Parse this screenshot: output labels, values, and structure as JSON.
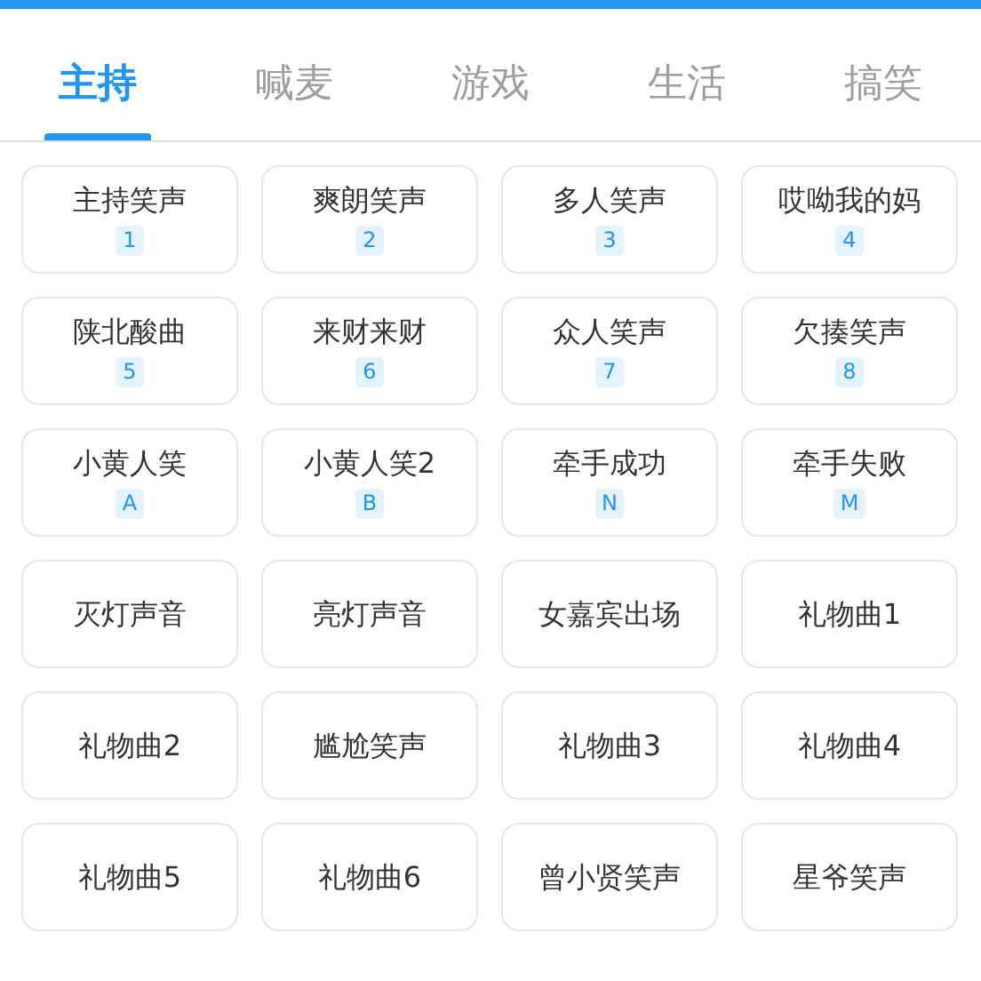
{
  "tabs": [
    {
      "label": "主持",
      "selected": true
    },
    {
      "label": "喊麦",
      "selected": false
    },
    {
      "label": "游戏",
      "selected": false
    },
    {
      "label": "生活",
      "selected": false
    },
    {
      "label": "搞笑",
      "selected": false
    }
  ],
  "sounds": [
    {
      "label": "主持笑声",
      "shortcut": "1"
    },
    {
      "label": "爽朗笑声",
      "shortcut": "2"
    },
    {
      "label": "多人笑声",
      "shortcut": "3"
    },
    {
      "label": "哎呦我的妈",
      "shortcut": "4"
    },
    {
      "label": "陕北酸曲",
      "shortcut": "5"
    },
    {
      "label": "来财来财",
      "shortcut": "6"
    },
    {
      "label": "众人笑声",
      "shortcut": "7"
    },
    {
      "label": "欠揍笑声",
      "shortcut": "8"
    },
    {
      "label": "小黄人笑",
      "shortcut": "A"
    },
    {
      "label": "小黄人笑2",
      "shortcut": "B"
    },
    {
      "label": "牵手成功",
      "shortcut": "N"
    },
    {
      "label": "牵手失败",
      "shortcut": "M"
    },
    {
      "label": "灭灯声音"
    },
    {
      "label": "亮灯声音"
    },
    {
      "label": "女嘉宾出场"
    },
    {
      "label": "礼物曲1"
    },
    {
      "label": "礼物曲2"
    },
    {
      "label": "尴尬笑声"
    },
    {
      "label": "礼物曲3"
    },
    {
      "label": "礼物曲4"
    },
    {
      "label": "礼物曲5"
    },
    {
      "label": "礼物曲6"
    },
    {
      "label": "曾小贤笑声"
    },
    {
      "label": "星爷笑声"
    }
  ]
}
